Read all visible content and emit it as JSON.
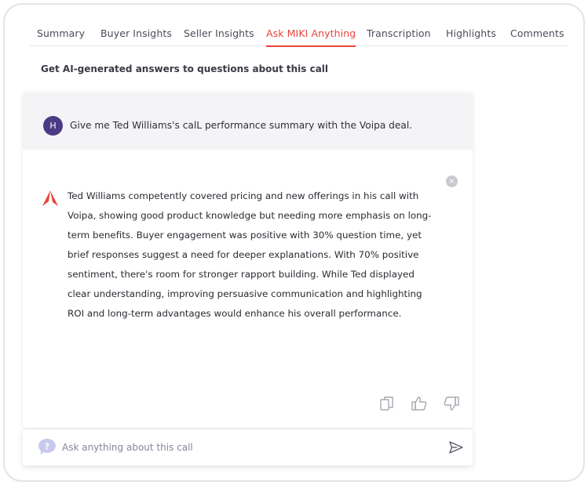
{
  "tabs": [
    {
      "label": "Summary",
      "active": false
    },
    {
      "label": "Buyer Insights",
      "active": false
    },
    {
      "label": "Seller Insights",
      "active": false
    },
    {
      "label": "Ask MIKI Anything",
      "active": true
    },
    {
      "label": "Transcription",
      "active": false
    },
    {
      "label": "Highlights",
      "active": false
    },
    {
      "label": "Comments",
      "active": false
    }
  ],
  "subtitle": "Get AI-generated answers to questions about this call",
  "question": {
    "avatar_initial": "H",
    "text": "Give me Ted Williams's calL performance summary with the Voipa deal."
  },
  "answer": {
    "text": "Ted Williams competently covered pricing and new offerings in his call with Voipa, showing good product knowledge but needing more emphasis on long-term benefits. Buyer engagement was positive with 30% question time, yet brief responses suggest a need for deeper explanations. With 70% positive sentiment, there's room for stronger rapport building. While Ted displayed clear understanding, improving persuasive communication and highlighting ROI and long-term advantages would enhance his overall performance."
  },
  "close_glyph": "×",
  "feedback_icons": [
    "copy-icon",
    "thumbs-up-icon",
    "thumbs-down-icon"
  ],
  "ask": {
    "placeholder": "Ask anything about this call",
    "value": ""
  },
  "colors": {
    "accent": "#e8453c",
    "avatar": "#4b3a86",
    "help_bubble": "#c9c9ef",
    "question_bg": "#f4f4f6"
  }
}
